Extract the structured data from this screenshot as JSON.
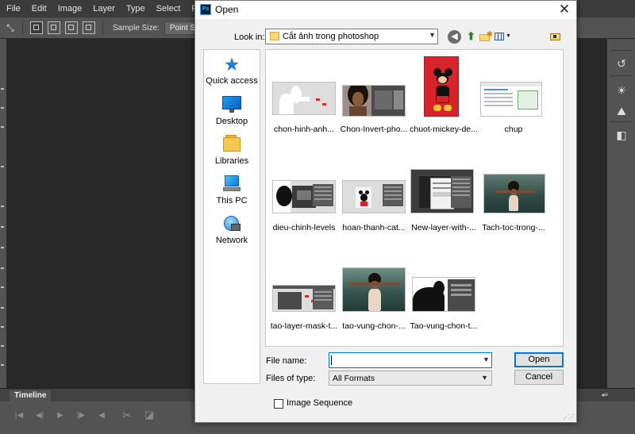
{
  "photoshop": {
    "menu": [
      "File",
      "Edit",
      "Image",
      "Layer",
      "Type",
      "Select",
      "Fil"
    ],
    "options_bar": {
      "sample_size_label": "Sample Size:",
      "sample_size_value": "Point Sample"
    },
    "timeline": {
      "tab_label": "Timeline"
    }
  },
  "dialog": {
    "title": "Open",
    "app_icon_text": "Ps",
    "look_in": {
      "label": "Look in:",
      "value": "Cắt ảnh trong photoshop"
    },
    "places": [
      {
        "label": "Quick access",
        "icon": "star-icon"
      },
      {
        "label": "Desktop",
        "icon": "desktop-icon"
      },
      {
        "label": "Libraries",
        "icon": "libraries-icon"
      },
      {
        "label": "This PC",
        "icon": "computer-icon"
      },
      {
        "label": "Network",
        "icon": "network-icon"
      }
    ],
    "files": [
      {
        "name": "chon-hinh-anh..."
      },
      {
        "name": "Chon-Invert-pho..."
      },
      {
        "name": "chuot-mickey-de..."
      },
      {
        "name": "chup"
      },
      {
        "name": "dieu-chinh-levels"
      },
      {
        "name": "hoan-thanh-cat..."
      },
      {
        "name": "New-layer-with-..."
      },
      {
        "name": "Tach-toc-trong-..."
      },
      {
        "name": "tao-layer-mask-t..."
      },
      {
        "name": "tao-vung-chon-..."
      },
      {
        "name": "Tao-vung-chon-t..."
      }
    ],
    "file_name": {
      "label": "File name:",
      "value": ""
    },
    "files_of_type": {
      "label": "Files of type:",
      "value": "All Formats"
    },
    "buttons": {
      "open": "Open",
      "cancel": "Cancel"
    },
    "image_sequence": {
      "label": "Image Sequence",
      "checked": false
    },
    "accent_color": "#0078d7"
  }
}
